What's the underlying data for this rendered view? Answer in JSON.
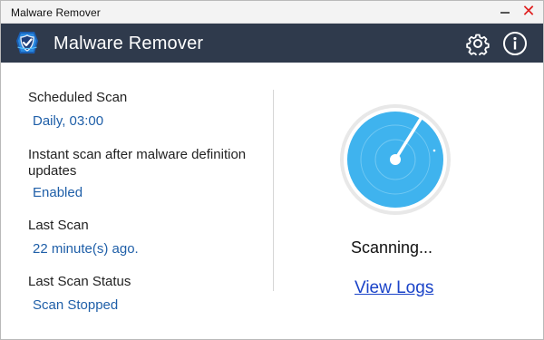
{
  "window": {
    "title": "Malware Remover",
    "close_glyph": "✕"
  },
  "header": {
    "app_name": "Malware Remover",
    "logo_icon": "shield-icon",
    "settings_icon": "gear-icon",
    "info_icon": "info-icon"
  },
  "details": {
    "scheduled_scan_label": "Scheduled Scan",
    "scheduled_scan_value": "Daily, 03:00",
    "instant_scan_label": "Instant scan after malware definition updates",
    "instant_scan_value": "Enabled",
    "last_scan_label": "Last Scan",
    "last_scan_value": "22 minute(s) ago.",
    "last_scan_status_label": "Last Scan Status",
    "last_scan_status_value": "Scan Stopped"
  },
  "scan": {
    "status_text": "Scanning...",
    "view_logs_label": "View Logs"
  },
  "colors": {
    "header_bg": "#2f3a4c",
    "radar_fill": "#3fb3ee",
    "value_text": "#1f5fa8",
    "link": "#1a43c8",
    "close": "#e02020"
  }
}
